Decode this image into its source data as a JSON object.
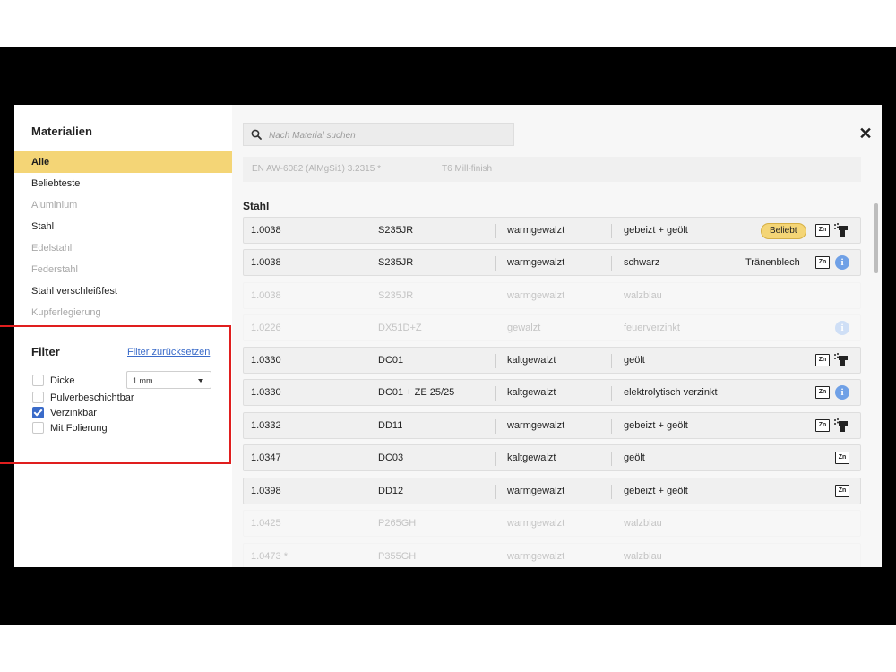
{
  "sidebar": {
    "title": "Materialien",
    "items": [
      {
        "label": "Alle",
        "state": "active"
      },
      {
        "label": "Beliebteste",
        "state": "normal"
      },
      {
        "label": "Aluminium",
        "state": "disabled"
      },
      {
        "label": "Stahl",
        "state": "normal"
      },
      {
        "label": "Edelstahl",
        "state": "disabled"
      },
      {
        "label": "Federstahl",
        "state": "disabled"
      },
      {
        "label": "Stahl verschleißfest",
        "state": "normal"
      },
      {
        "label": "Kupferlegierung",
        "state": "disabled"
      }
    ]
  },
  "filter": {
    "title": "Filter",
    "reset_label": "Filter zurücksetzen",
    "options": [
      {
        "label": "Dicke",
        "checked": false
      },
      {
        "label": "Pulverbeschichtbar",
        "checked": false
      },
      {
        "label": "Verzinkbar",
        "checked": true
      },
      {
        "label": "Mit Folierung",
        "checked": false
      }
    ],
    "thickness_value": "1 mm"
  },
  "search": {
    "placeholder": "Nach Material suchen"
  },
  "top_row": {
    "col1": "EN AW-6082 (AlMgSi1) 3.2315 *",
    "col2": "T6 Mill-finish"
  },
  "section_title": "Stahl",
  "rows": [
    {
      "c1": "1.0038",
      "c2": "S235JR",
      "c3": "warmgewalzt",
      "c4": "gebeizt + geölt",
      "badge": "Beliebt",
      "zn": true,
      "spray": true,
      "faded": false
    },
    {
      "c1": "1.0038",
      "c2": "S235JR",
      "c3": "warmgewalzt",
      "c4": "schwarz",
      "note": "Tränenblech",
      "zn": true,
      "info": true,
      "faded": false
    },
    {
      "c1": "1.0038",
      "c2": "S235JR",
      "c3": "warmgewalzt",
      "c4": "walzblau",
      "faded": true
    },
    {
      "c1": "1.0226",
      "c2": "DX51D+Z",
      "c3": "gewalzt",
      "c4": "feuerverzinkt",
      "info": true,
      "faded": true
    },
    {
      "c1": "1.0330",
      "c2": "DC01",
      "c3": "kaltgewalzt",
      "c4": "geölt",
      "zn": true,
      "spray": true,
      "faded": false
    },
    {
      "c1": "1.0330",
      "c2": "DC01 + ZE 25/25",
      "c3": "kaltgewalzt",
      "c4": "elektrolytisch verzinkt",
      "zn": true,
      "info": true,
      "faded": false
    },
    {
      "c1": "1.0332",
      "c2": "DD11",
      "c3": "warmgewalzt",
      "c4": "gebeizt + geölt",
      "zn": true,
      "spray": true,
      "faded": false
    },
    {
      "c1": "1.0347",
      "c2": "DC03",
      "c3": "kaltgewalzt",
      "c4": "geölt",
      "zn": true,
      "faded": false
    },
    {
      "c1": "1.0398",
      "c2": "DD12",
      "c3": "warmgewalzt",
      "c4": "gebeizt + geölt",
      "zn": true,
      "faded": false
    },
    {
      "c1": "1.0425",
      "c2": "P265GH",
      "c3": "warmgewalzt",
      "c4": "walzblau",
      "faded": true
    },
    {
      "c1": "1.0473 *",
      "c2": "P355GH",
      "c3": "warmgewalzt",
      "c4": "walzblau",
      "faded": true
    }
  ],
  "icons": {
    "zn_label": "Zn",
    "info_glyph": "i",
    "close_glyph": "✕"
  },
  "colors": {
    "accent": "#f4d576",
    "link": "#3a6bc9",
    "info": "#6fa0e6",
    "annotation": "#e01e1e"
  }
}
